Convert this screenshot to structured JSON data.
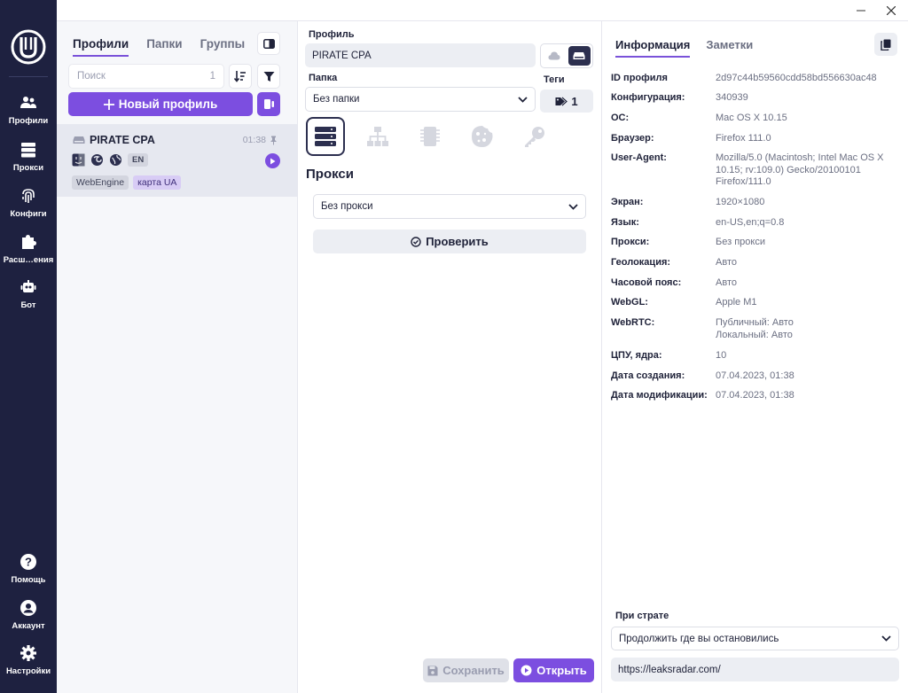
{
  "rail": {
    "items": [
      {
        "label": "Профили",
        "icon": "users-icon"
      },
      {
        "label": "Прокси",
        "icon": "server-icon"
      },
      {
        "label": "Конфиги",
        "icon": "fingerprint-icon"
      },
      {
        "label": "Расш…ения",
        "icon": "puzzle-icon"
      },
      {
        "label": "Бот",
        "icon": "robot-icon"
      }
    ],
    "bottom": [
      {
        "label": "Помощь",
        "icon": "help-icon"
      },
      {
        "label": "Аккаунт",
        "icon": "account-icon"
      },
      {
        "label": "Настройки",
        "icon": "gear-icon"
      }
    ]
  },
  "profiles_panel": {
    "tabs": [
      "Профили",
      "Папки",
      "Группы"
    ],
    "search_placeholder": "Поиск",
    "search_count": "1",
    "new_profile_label": "Новый профиль",
    "profile": {
      "name": "PIRATE CPA",
      "time": "01:38",
      "lang": "EN",
      "tags": [
        "WebEngine",
        "карта UA"
      ]
    }
  },
  "editor": {
    "profile_label": "Профиль",
    "profile_value": "PIRATE CPA",
    "folder_label": "Папка",
    "folder_value": "Без папки",
    "tags_label": "Теги",
    "tags_count": "1",
    "section_title": "Прокси",
    "proxy_value": "Без прокси",
    "check_label": "Проверить",
    "save_label": "Сохранить",
    "open_label": "Открыть"
  },
  "info": {
    "tabs": [
      "Информация",
      "Заметки"
    ],
    "rows": [
      {
        "key": "ID профиля",
        "value": "2d97c44b59560cdd58bd556630ac48"
      },
      {
        "key": "Конфигурация:",
        "value": "340939"
      },
      {
        "key": "ОС:",
        "value": "Mac OS X 10.15"
      },
      {
        "key": "Браузер:",
        "value": "Firefox 111.0"
      },
      {
        "key": "User-Agent:",
        "value": "Mozilla/5.0 (Macintosh; Intel Mac OS X 10.15; rv:109.0) Gecko/20100101 Firefox/111.0"
      },
      {
        "key": "Экран:",
        "value": "1920×1080"
      },
      {
        "key": "Язык:",
        "value": "en-US,en;q=0.8"
      },
      {
        "key": "Прокси:",
        "value": "Без прокси"
      },
      {
        "key": "Геолокация:",
        "value": "Авто"
      },
      {
        "key": "Часовой пояс:",
        "value": "Авто"
      },
      {
        "key": "WebGL:",
        "value": "Apple M1"
      },
      {
        "key": "WebRTC:",
        "value": "Публичный: Авто\nЛокальный: Авто"
      },
      {
        "key": "ЦПУ, ядра:",
        "value": "10"
      },
      {
        "key": "Дата создания:",
        "value": "07.04.2023, 01:38"
      },
      {
        "key": "Дата модификации:",
        "value": "07.04.2023, 01:38"
      }
    ],
    "start_label": "При страте",
    "start_value": "Продолжить где вы остановились",
    "start_url": "https://leaksradar.com/"
  },
  "colors": {
    "rail_bg": "#1e2140",
    "accent": "#7c4ee0",
    "panel_bg": "#f6f7fa"
  }
}
